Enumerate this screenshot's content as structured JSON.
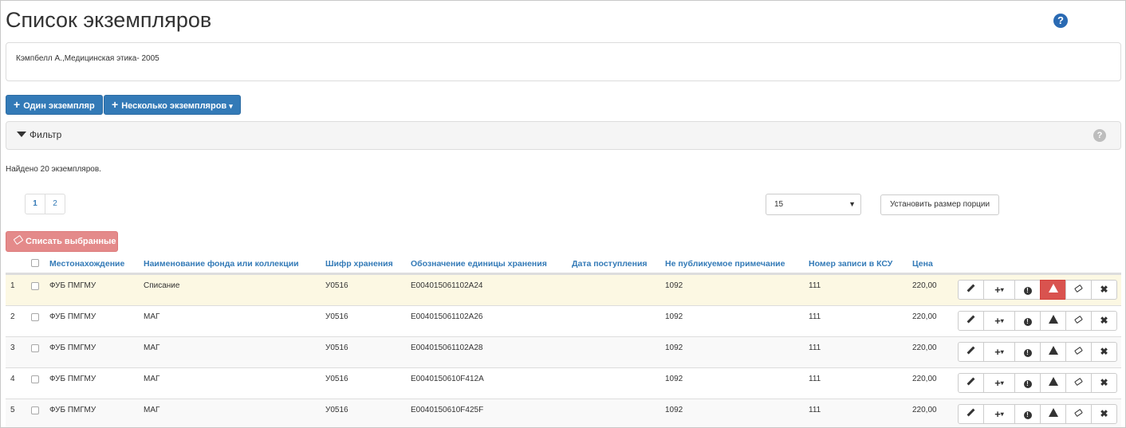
{
  "page": {
    "title": "Список экземпляров",
    "help_icon": "question-circle-icon"
  },
  "book": {
    "description": "Кэмпбелл А.,Медицинская этика- 2005"
  },
  "toolbar": {
    "single_label": "Один экземпляр",
    "multiple_label": "Несколько экземпляров",
    "plus_glyph": "+",
    "caret_glyph": "▾"
  },
  "filter": {
    "label": "Фильтр"
  },
  "results": {
    "found_text": "Найдено 20 экземпляров.",
    "pages": [
      "1",
      "2"
    ],
    "page_size": "15",
    "set_size_label": "Установить размер порции"
  },
  "bulk": {
    "writeoff_label": "Списать выбранные"
  },
  "table": {
    "columns": {
      "location": "Местонахождение",
      "fund": "Наименование фонда или коллекции",
      "shelfmark": "Шифр хранения",
      "unit": "Обозначение единицы хранения",
      "date": "Дата поступления",
      "note": "Не публикуемое примечание",
      "ksu": "Номер записи в КСУ",
      "price": "Цена"
    },
    "rows": [
      {
        "n": "1",
        "location": "ФУБ ПМГМУ",
        "fund": "Списание",
        "shelfmark": "У0516",
        "unit": "E004015061102A24",
        "date": "",
        "note": "1092",
        "ksu": "111",
        "price": "220,00"
      },
      {
        "n": "2",
        "location": "ФУБ ПМГМУ",
        "fund": "МАГ",
        "shelfmark": "У0516",
        "unit": "E004015061102A26",
        "date": "",
        "note": "1092",
        "ksu": "111",
        "price": "220,00"
      },
      {
        "n": "3",
        "location": "ФУБ ПМГМУ",
        "fund": "МАГ",
        "shelfmark": "У0516",
        "unit": "E004015061102A28",
        "date": "",
        "note": "1092",
        "ksu": "111",
        "price": "220,00"
      },
      {
        "n": "4",
        "location": "ФУБ ПМГМУ",
        "fund": "МАГ",
        "shelfmark": "У0516",
        "unit": "E0040150610F412A",
        "date": "",
        "note": "1092",
        "ksu": "111",
        "price": "220,00"
      },
      {
        "n": "5",
        "location": "ФУБ ПМГМУ",
        "fund": "МАГ",
        "shelfmark": "У0516",
        "unit": "E0040150610F425F",
        "date": "",
        "note": "1092",
        "ksu": "111",
        "price": "220,00"
      }
    ],
    "row_icons": [
      "pencil-icon",
      "plus-dropdown-icon",
      "info-icon",
      "warning-icon",
      "eraser-icon",
      "close-icon"
    ]
  },
  "colors": {
    "primary": "#337ab7",
    "danger": "#d9534f",
    "highlight_row": "#fcf8e3"
  }
}
